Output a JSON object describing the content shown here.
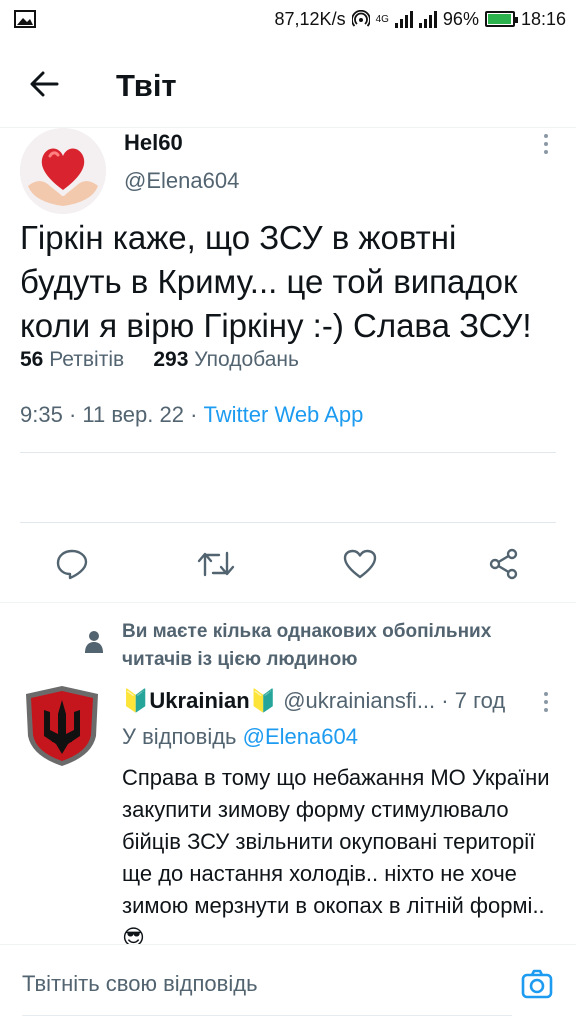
{
  "status_bar": {
    "network_speed": "87,12K/s",
    "network_type": "4G",
    "battery_percent": "96%",
    "battery_level": 0.96,
    "time": "18:16",
    "icons": [
      "gallery-icon",
      "hotspot-icon",
      "signal-icon",
      "battery-icon"
    ]
  },
  "header": {
    "title": "Твіт",
    "back_icon": "arrow-left-icon"
  },
  "tweet": {
    "author_name": "Hel60",
    "author_handle": "@Elena604",
    "text": "Гіркін каже, що ЗСУ в жовтні будуть в Криму... це той випадок коли я вірю Гіркіну :-) Слава ЗСУ!",
    "time": "9:35",
    "date": "11 вер. 22",
    "source": "Twitter Web App",
    "retweets_count": "56",
    "retweets_label": "Ретвітів",
    "likes_count": "293",
    "likes_label": "Уподобань"
  },
  "actions": [
    {
      "name": "reply",
      "icon": "reply-icon"
    },
    {
      "name": "retweet",
      "icon": "retweet-icon"
    },
    {
      "name": "like",
      "icon": "heart-icon"
    },
    {
      "name": "share",
      "icon": "share-icon"
    }
  ],
  "social_context": {
    "text": "Ви маєте кілька однакових обопільних читачів із цією людиною",
    "icon": "person-icon"
  },
  "reply": {
    "name_prefix": "🔰",
    "name": "Ukrainian",
    "name_suffix": "🔰",
    "handle": "@ukrainiansfi...",
    "time": "· 7 год",
    "replying_label": "У відповідь",
    "replying_to": "@Elena604",
    "text": "Справа в тому що небажання МО України закупити зимову форму стимулювало бійців ЗСУ звільнити окуповані території ще до настання холодів.. ніхто не хоче зимою мерзнути в окопах в літній формі..😎"
  },
  "composer": {
    "placeholder": "Твітніть свою відповідь",
    "camera_icon": "camera-icon"
  },
  "colors": {
    "accent": "#1d9bf0",
    "text_primary": "#0f1419",
    "text_secondary": "#536471",
    "battery_fill": "#2bb24c"
  }
}
